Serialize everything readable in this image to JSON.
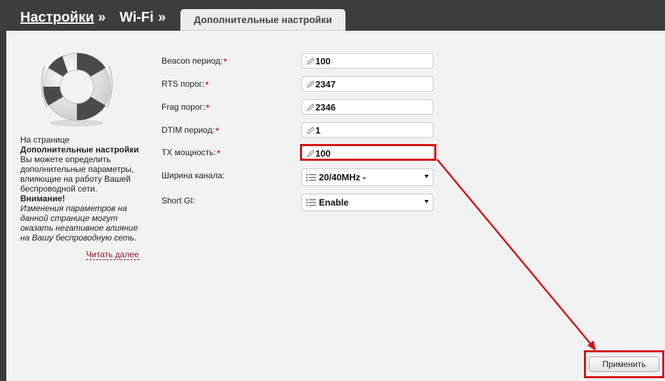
{
  "breadcrumb": {
    "items": [
      "Настройки",
      "Wi-Fi"
    ],
    "separator": "»",
    "active_tab": "Дополнительные настройки"
  },
  "help": {
    "line1": "На странице",
    "page_name": "Дополнительные настройки",
    "description": "Вы можете определить дополнительные параметры, влияющие на работу Вашей беспроводной сети.",
    "warning_title": "Внимание!",
    "warning_text": "Изменения параметров на данной странице могут оказать негативное влияние на Вашу беспроводную сеть.",
    "read_more": "Читать далее"
  },
  "form": {
    "beacon": {
      "label": "Beacon период:",
      "value": "100"
    },
    "rts": {
      "label": "RTS порог:",
      "value": "2347"
    },
    "frag": {
      "label": "Frag порог:",
      "value": "2346"
    },
    "dtim": {
      "label": "DTIM период:",
      "value": "1"
    },
    "tx": {
      "label": "TX мощность:",
      "value": "100"
    },
    "bandwidth": {
      "label": "Ширина канала:",
      "value": "20/40MHz -"
    },
    "short_gi": {
      "label": "Short GI:",
      "value": "Enable"
    },
    "required_mark": "*"
  },
  "actions": {
    "apply": "Применить"
  },
  "colors": {
    "accent_red": "#d3131a",
    "header_bg": "#3d3d3d",
    "panel_bg": "#f2f2f2",
    "link": "#8b1a1a"
  },
  "icons": [
    "lifebuoy-icon",
    "pencil-icon",
    "list-icon",
    "dropdown-arrow-icon"
  ]
}
